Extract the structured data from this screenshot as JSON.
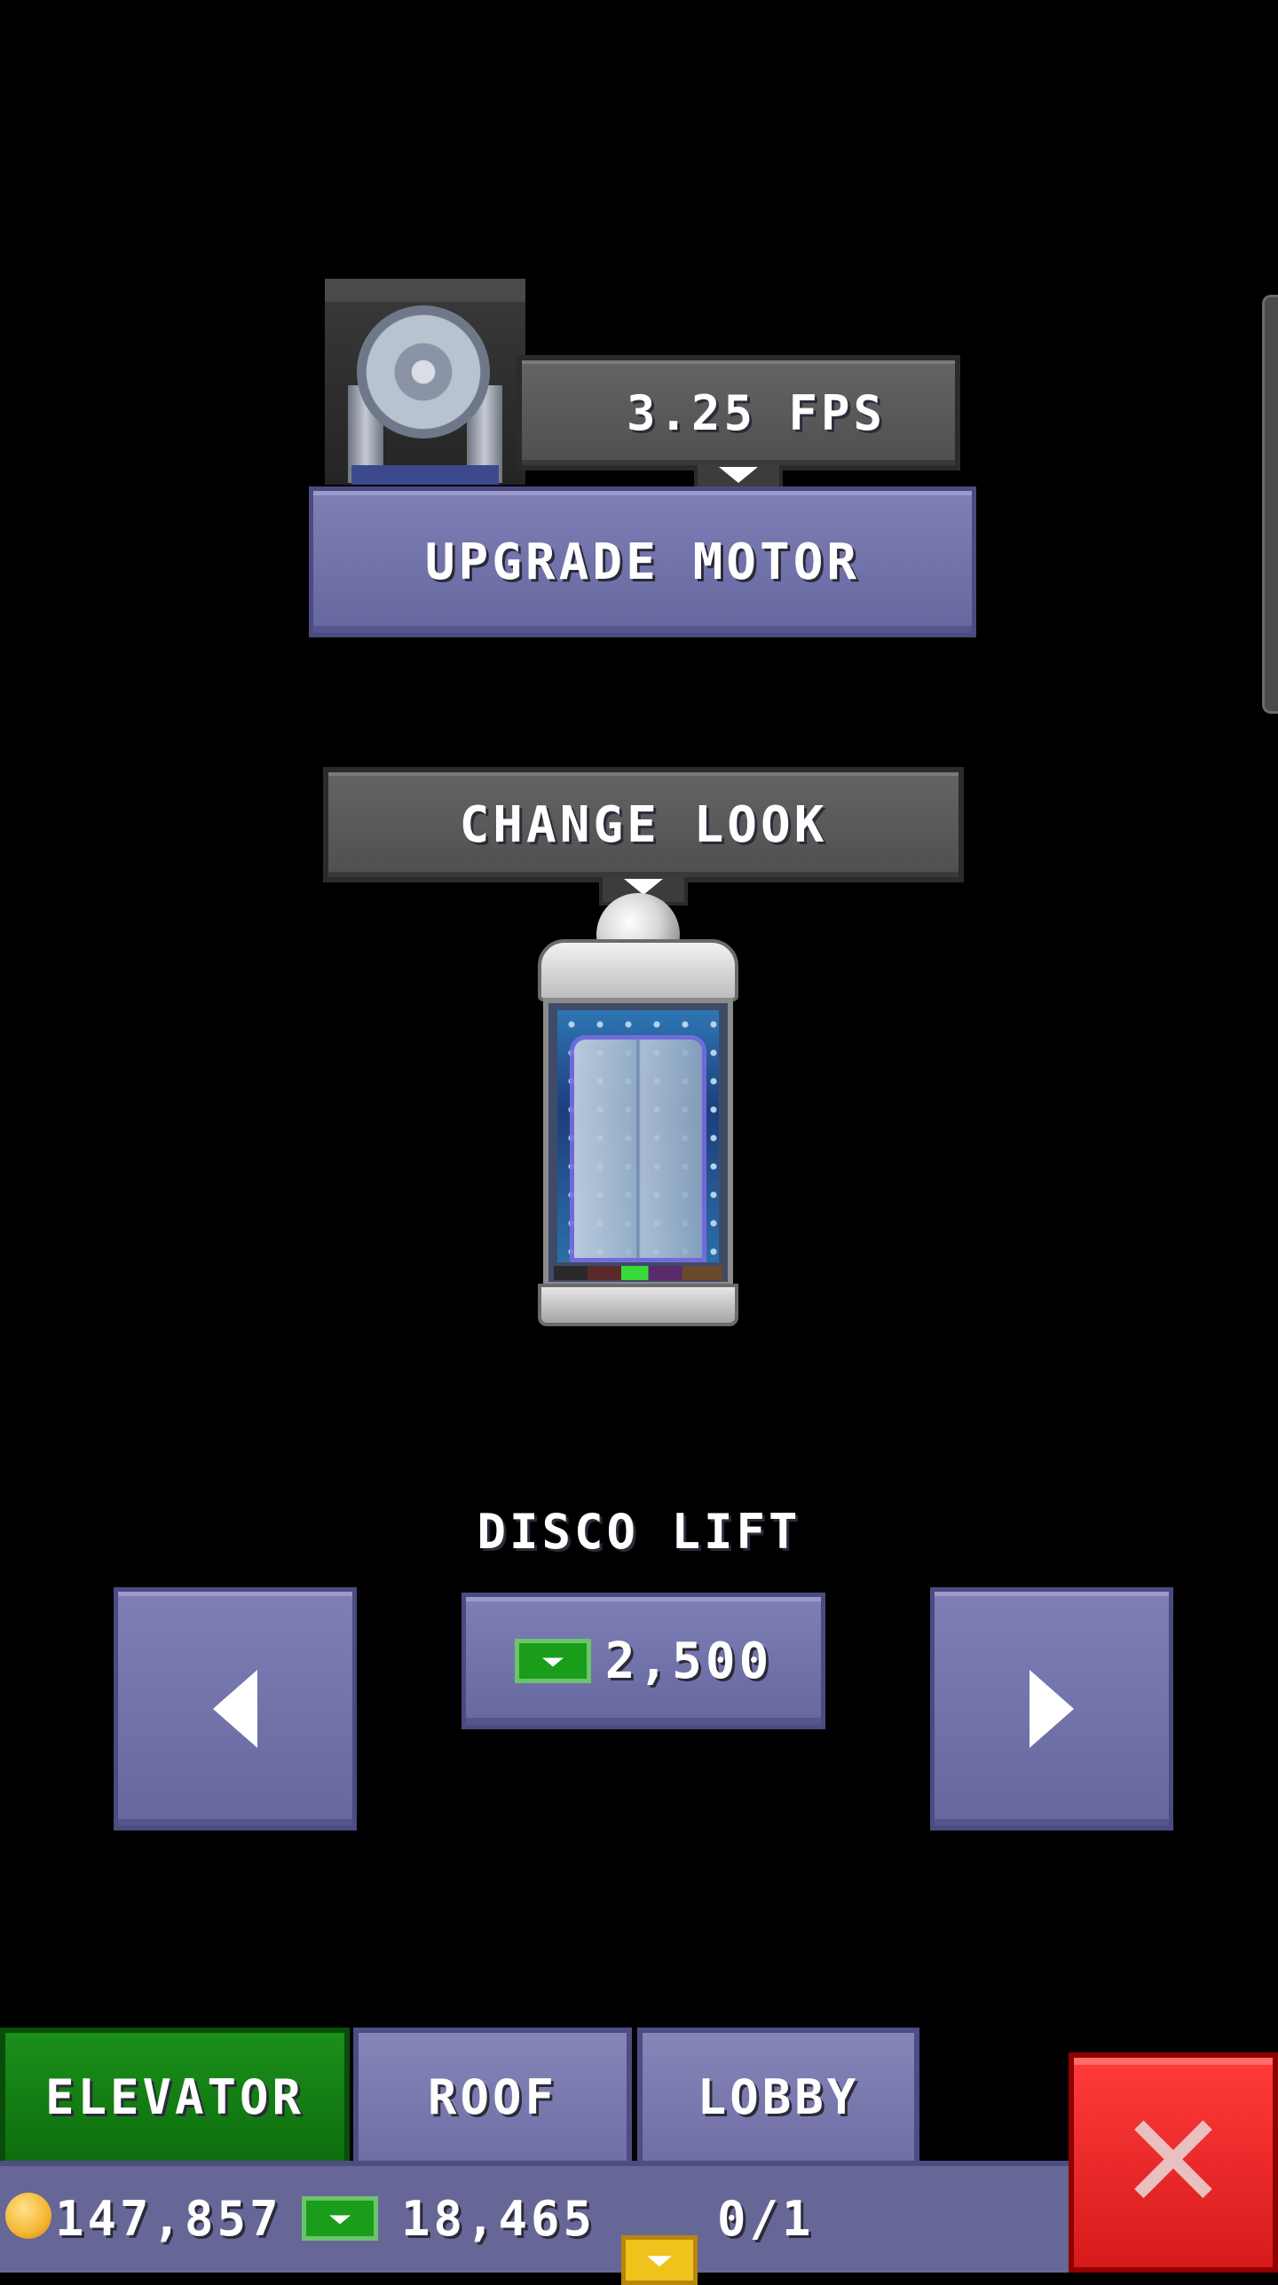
{
  "motor": {
    "speed_label": "3.25 FPS",
    "upgrade_label": "UPGRADE MOTOR"
  },
  "look": {
    "change_label": "CHANGE LOOK",
    "item_name": "DISCO LIFT",
    "price": "2,500"
  },
  "tabs": [
    {
      "label": "ELEVATOR",
      "active": true
    },
    {
      "label": "ROOF",
      "active": false
    },
    {
      "label": "LOBBY",
      "active": false
    }
  ],
  "status": {
    "coins": "147,857",
    "bux": "18,465",
    "tickets": "0/1"
  },
  "colors": {
    "accent_purple": "#7373ad",
    "active_tab_green": "#1a8f1a",
    "close_red": "#e82a2a"
  }
}
